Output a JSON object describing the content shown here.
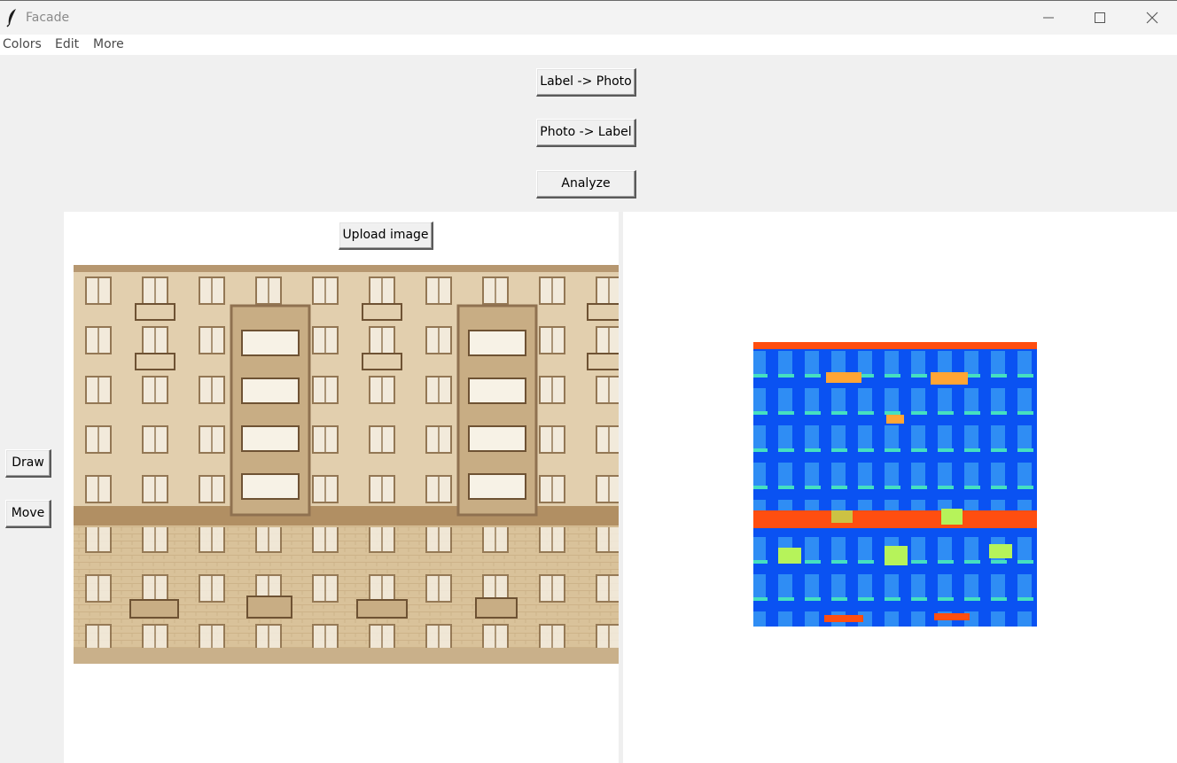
{
  "window": {
    "title": "Facade",
    "icon": "feather-icon",
    "controls": {
      "minimize": "minimize-icon",
      "maximize": "maximize-icon",
      "close": "close-icon"
    }
  },
  "menu": {
    "items": [
      "Colors",
      "Edit",
      "More"
    ]
  },
  "toolbar": {
    "label_to_photo": "Label -> Photo",
    "photo_to_label": "Photo -> Label",
    "analyze": "Analyze"
  },
  "left_tools": {
    "draw": "Draw",
    "move": "Move"
  },
  "upload": {
    "label": "Upload image"
  },
  "colors": {
    "window_bg": "#f0f0f0",
    "panel_bg": "#ffffff",
    "facade_wall": "#dfc9a4",
    "label_background": "#0a52f2",
    "label_window": "#2f8df4",
    "label_cornice": "#ff4e10",
    "label_balcony": "#ffa534",
    "label_sill": "#45e0c0",
    "label_shop": "#b6f35a"
  }
}
